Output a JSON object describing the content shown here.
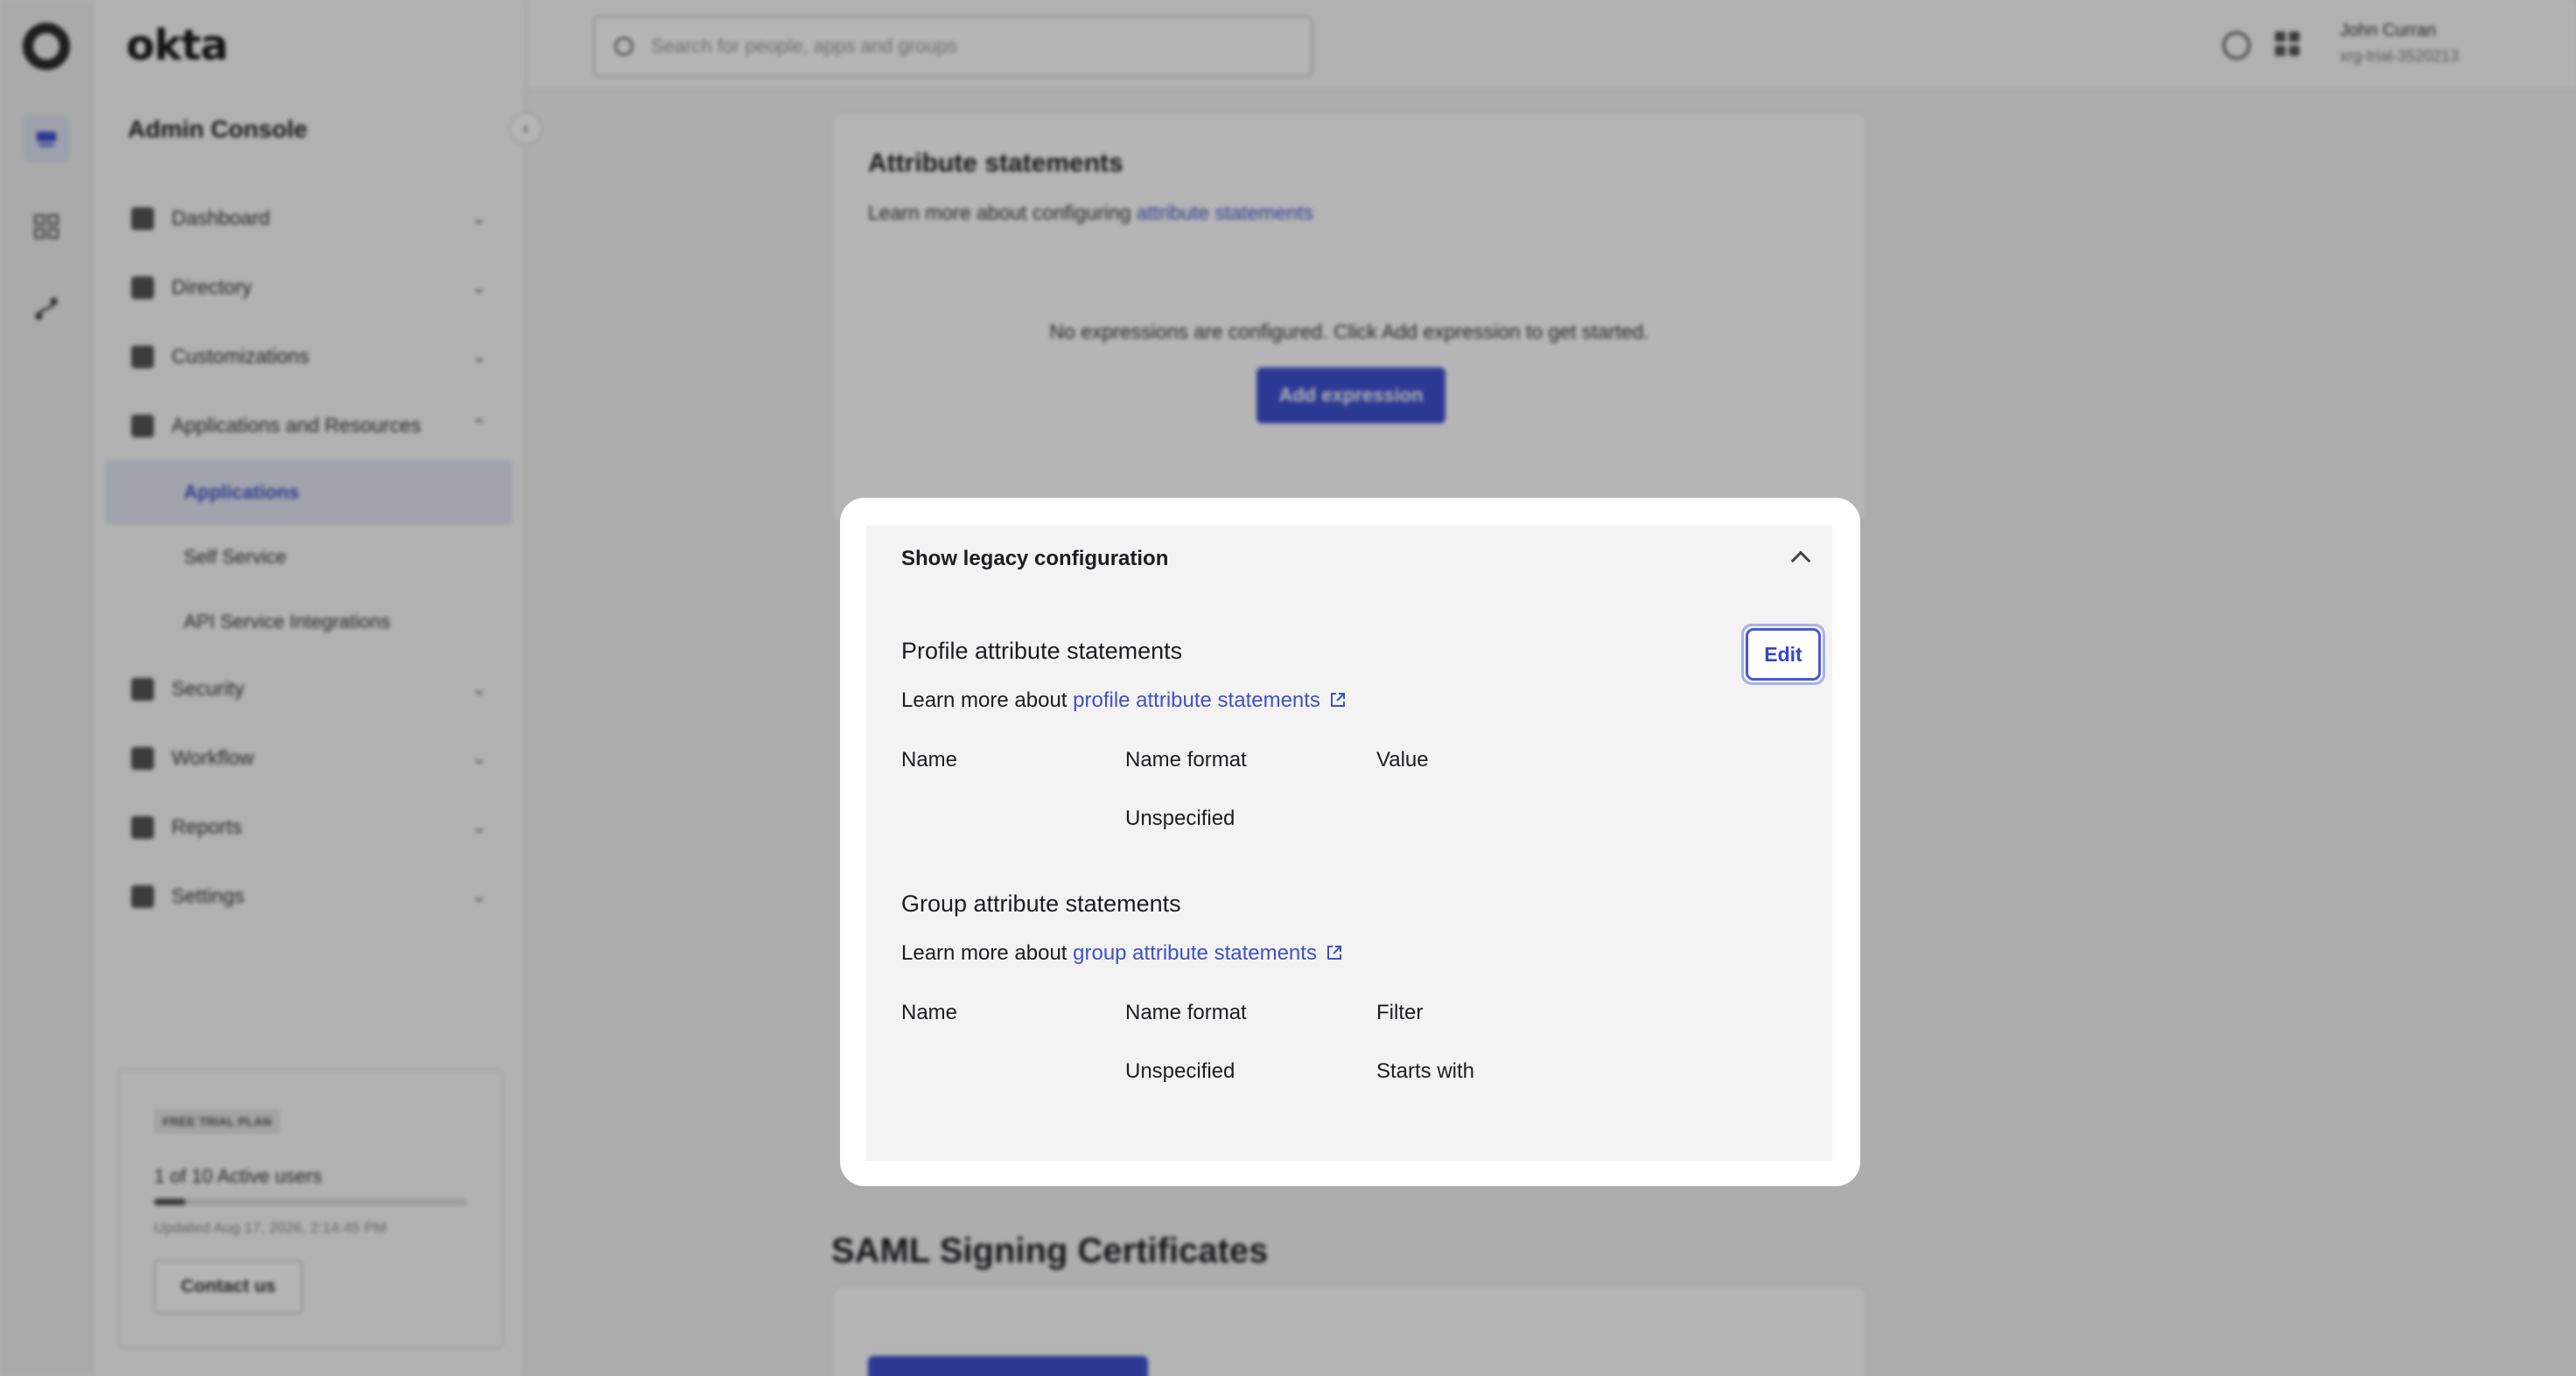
{
  "brand": "okta",
  "sidebar": {
    "title": "Admin Console",
    "items": [
      {
        "label": "Dashboard",
        "chevron": "chevron-down"
      },
      {
        "label": "Directory",
        "chevron": "chevron-down"
      },
      {
        "label": "Customizations",
        "chevron": "chevron-down"
      },
      {
        "label": "Applications and Resources",
        "chevron": "chevron-up"
      },
      {
        "label": "Security",
        "chevron": "chevron-down"
      },
      {
        "label": "Workflow",
        "chevron": "chevron-down"
      },
      {
        "label": "Reports",
        "chevron": "chevron-down"
      },
      {
        "label": "Settings",
        "chevron": "chevron-down"
      }
    ],
    "subitems": [
      {
        "label": "Applications",
        "active": true
      },
      {
        "label": "Self Service",
        "active": false
      },
      {
        "label": "API Service Integrations",
        "active": false
      }
    ],
    "trial": {
      "badge": "FREE TRIAL PLAN",
      "users": "1 of 10 Active users",
      "active_users_fraction": 0.1,
      "updated": "Updated Aug 17, 2026, 2:14:45 PM",
      "contact_label": "Contact us"
    }
  },
  "topbar": {
    "search_placeholder": "Search for people, apps and groups",
    "user_name": "John Curran",
    "user_org": "xrg-trial-3520213"
  },
  "attribute_statements": {
    "title": "Attribute statements",
    "learn_prefix": "Learn more about configuring ",
    "learn_link": "attribute statements",
    "empty_text": "No expressions are configured. Click Add expression to get started.",
    "add_button": "Add expression"
  },
  "saml_title": "SAML Signing Certificates",
  "modal": {
    "toggle_label": "Show legacy configuration",
    "edit_label": "Edit",
    "profile": {
      "title": "Profile attribute statements",
      "learn_prefix": "Learn more about ",
      "learn_link": "profile attribute statements",
      "headers": [
        "Name",
        "Name format",
        "Value"
      ],
      "row": [
        "",
        "Unspecified",
        ""
      ]
    },
    "group": {
      "title": "Group attribute statements",
      "learn_prefix": "Learn more about ",
      "learn_link": "group attribute statements",
      "headers": [
        "Name",
        "Name format",
        "Filter"
      ],
      "row": [
        "",
        "Unspecified",
        "Starts with"
      ]
    }
  },
  "colors": {
    "accent": "#3f51d1",
    "link": "#4051c5",
    "overlay": "rgba(0,0,0,0.29)"
  }
}
